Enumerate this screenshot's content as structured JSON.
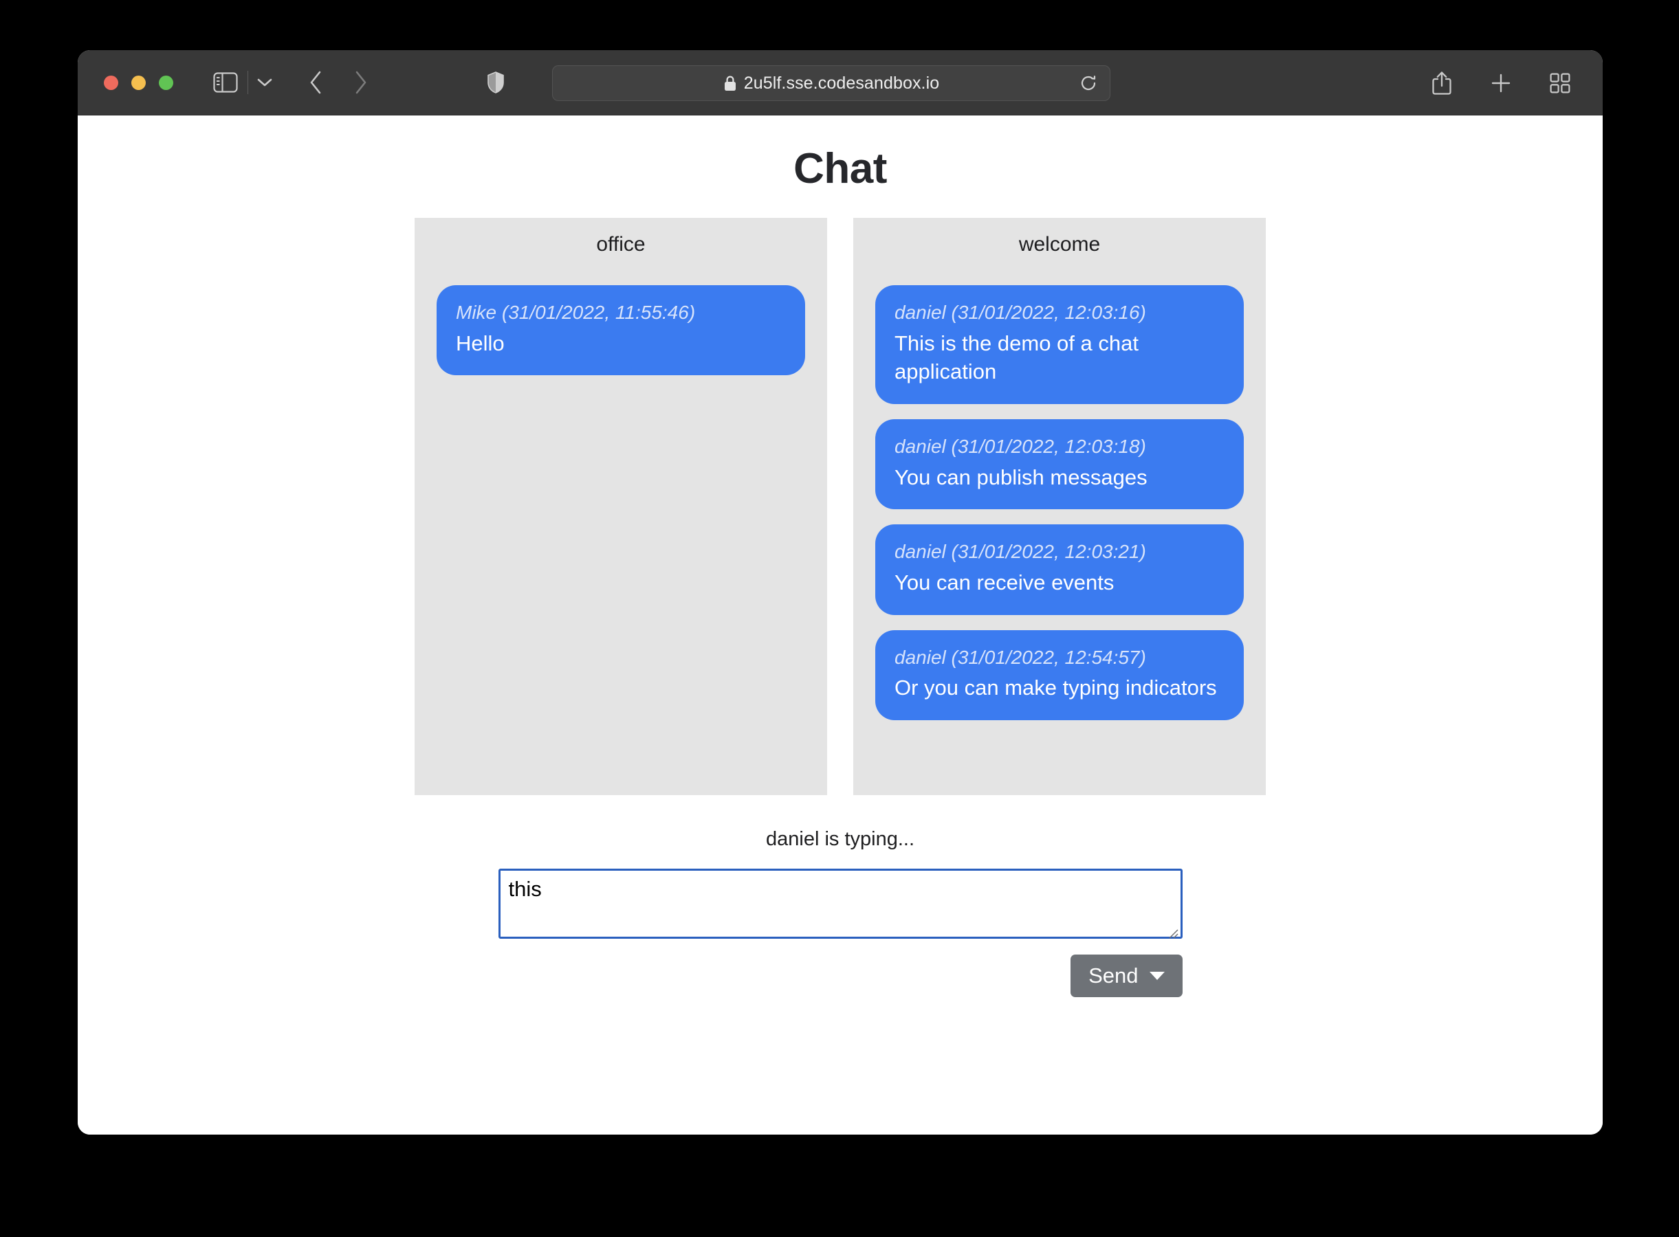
{
  "browser": {
    "url": "2u5lf.sse.codesandbox.io",
    "secure_icon": "lock-icon",
    "traffic_lights": [
      "close",
      "minimize",
      "zoom"
    ],
    "toolbar_icons": {
      "sidebar": "sidebar-toggle-icon",
      "sidebar_chevron": "chevron-down-icon",
      "back": "back-chevron-icon",
      "forward": "forward-chevron-icon",
      "shield": "privacy-shield-icon",
      "reload": "reload-icon",
      "share": "share-icon",
      "new_tab": "plus-icon",
      "tab_overview": "tab-overview-icon"
    },
    "colors": {
      "chrome": "#383838",
      "url_field": "#414141"
    }
  },
  "page": {
    "title": "Chat",
    "accent": "#3b7bf0",
    "panel_bg": "#e4e4e4",
    "channels": [
      {
        "name": "office",
        "messages": [
          {
            "meta": "Mike (31/01/2022, 11:55:46)",
            "body": "Hello"
          }
        ]
      },
      {
        "name": "welcome",
        "messages": [
          {
            "meta": "daniel (31/01/2022, 12:03:16)",
            "body": "This is the demo of a chat application"
          },
          {
            "meta": "daniel (31/01/2022, 12:03:18)",
            "body": "You can publish messages"
          },
          {
            "meta": "daniel (31/01/2022, 12:03:21)",
            "body": "You can receive events"
          },
          {
            "meta": "daniel (31/01/2022, 12:54:57)",
            "body": "Or you can make typing indicators"
          }
        ]
      }
    ],
    "typing_status": "daniel is typing...",
    "composer": {
      "value": "this",
      "placeholder": "",
      "send_label": "Send",
      "send_caret": "caret-down-icon"
    }
  }
}
